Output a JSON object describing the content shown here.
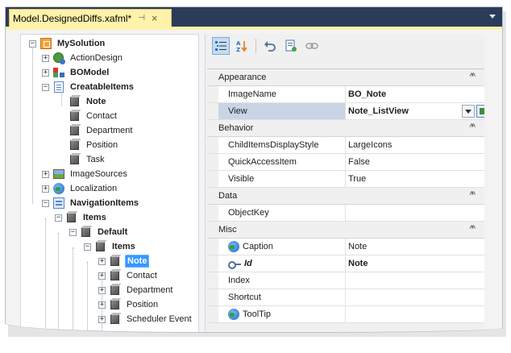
{
  "tab": {
    "title": "Model.DesignedDiffs.xafml*",
    "pin_glyph": "⊣",
    "close_glyph": "×"
  },
  "tree": {
    "items": [
      {
        "label": "MySolution",
        "icon": "solution-icon",
        "bold": true,
        "expander": "−"
      },
      {
        "label": "ActionDesign",
        "icon": "action-design-icon",
        "bold": false,
        "expander": "+"
      },
      {
        "label": "BOModel",
        "icon": "bomodel-icon",
        "bold": true,
        "expander": "+"
      },
      {
        "label": "CreatableItems",
        "icon": "creatable-items-icon",
        "bold": true,
        "expander": "−"
      },
      {
        "label": "Note",
        "icon": "node-icon",
        "bold": true,
        "expander": ""
      },
      {
        "label": "Contact",
        "icon": "node-icon",
        "bold": false,
        "expander": ""
      },
      {
        "label": "Department",
        "icon": "node-icon",
        "bold": false,
        "expander": ""
      },
      {
        "label": "Position",
        "icon": "node-icon",
        "bold": false,
        "expander": ""
      },
      {
        "label": "Task",
        "icon": "node-icon",
        "bold": false,
        "expander": ""
      },
      {
        "label": "ImageSources",
        "icon": "image-sources-icon",
        "bold": false,
        "expander": "+"
      },
      {
        "label": "Localization",
        "icon": "globe-icon",
        "bold": false,
        "expander": "+"
      },
      {
        "label": "NavigationItems",
        "icon": "navigation-items-icon",
        "bold": true,
        "expander": "−"
      },
      {
        "label": "Items",
        "icon": "node-icon",
        "bold": true,
        "expander": "−"
      },
      {
        "label": "Default",
        "icon": "node-icon",
        "bold": true,
        "expander": "−"
      },
      {
        "label": "Items",
        "icon": "node-icon",
        "bold": true,
        "expander": "−"
      },
      {
        "label": "Note",
        "icon": "node-icon",
        "bold": true,
        "expander": "+",
        "selected": true
      },
      {
        "label": "Contact",
        "icon": "node-icon",
        "bold": false,
        "expander": "+"
      },
      {
        "label": "Department",
        "icon": "node-icon",
        "bold": false,
        "expander": "+"
      },
      {
        "label": "Position",
        "icon": "node-icon",
        "bold": false,
        "expander": "+"
      },
      {
        "label": "Scheduler Event",
        "icon": "node-icon",
        "bold": false,
        "expander": "+"
      }
    ]
  },
  "toolbar": {
    "buttons": [
      "categorized-icon",
      "alphabetical-icon",
      "undo-icon",
      "properties-icon",
      "link-icon"
    ]
  },
  "propgrid": {
    "categories": [
      {
        "name": "Appearance",
        "rows": [
          {
            "name": "ImageName",
            "value": "BO_Note",
            "value_bold": true
          },
          {
            "name": "View",
            "value": "Note_ListView",
            "value_bold": true,
            "highlighted": true,
            "has_dropdown": true
          }
        ]
      },
      {
        "name": "Behavior",
        "rows": [
          {
            "name": "ChildItemsDisplayStyle",
            "value": "LargeIcons"
          },
          {
            "name": "QuickAccessItem",
            "value": "False"
          },
          {
            "name": "Visible",
            "value": "True"
          }
        ]
      },
      {
        "name": "Data",
        "rows": [
          {
            "name": "ObjectKey",
            "value": ""
          }
        ]
      },
      {
        "name": "Misc",
        "rows": [
          {
            "name": "Caption",
            "value": "Note",
            "icon": "globe"
          },
          {
            "name": "Id",
            "value": "Note",
            "icon": "key",
            "name_italic": true,
            "value_bold": true
          },
          {
            "name": "Index",
            "value": ""
          },
          {
            "name": "Shortcut",
            "value": ""
          },
          {
            "name": "ToolTip",
            "value": "",
            "icon": "globe"
          }
        ]
      }
    ],
    "collapse_glyph": "^^"
  }
}
